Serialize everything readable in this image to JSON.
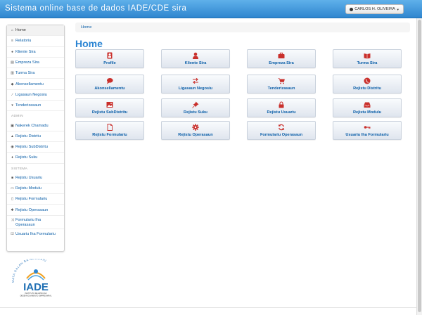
{
  "app": {
    "title": "Sistema online base de dados IADE/CDE sira",
    "user_label": "CARLOS H. OLIVEIRA"
  },
  "sidebar": {
    "items_main": [
      {
        "label": "Home",
        "icon": "home-icon"
      },
      {
        "label": "Relatoriu",
        "icon": "list-icon"
      },
      {
        "label": "Kliente Sira",
        "icon": "user-icon"
      },
      {
        "label": "Empreza Sira",
        "icon": "building-icon"
      },
      {
        "label": "Turma Sira",
        "icon": "book-icon"
      },
      {
        "label": "Akonsellamentu",
        "icon": "comment-icon"
      },
      {
        "label": "Ligasaun Negosiu",
        "icon": "link-icon"
      },
      {
        "label": "Tenderizasaun",
        "icon": "cart-icon"
      }
    ],
    "admin_header": "ADMIN",
    "items_admin": [
      {
        "label": "Nakerek Chamadu",
        "icon": "folder-icon"
      },
      {
        "label": "Rejistu Distritu",
        "icon": "road-icon"
      },
      {
        "label": "Rejistu SubDistritu",
        "icon": "globe-icon"
      },
      {
        "label": "Rejistu Suku",
        "icon": "map-marker-icon"
      }
    ],
    "sistema_header": "SISTEMA",
    "items_sistema": [
      {
        "label": "Rejistu Usuariu",
        "icon": "lock-icon"
      },
      {
        "label": "Rejistu Modulu",
        "icon": "inbox-icon"
      },
      {
        "label": "Rejistu Formulariu",
        "icon": "file-icon"
      },
      {
        "label": "Rejistu Operasaun",
        "icon": "cog-icon"
      },
      {
        "label": "Formulariu Iha Operasaun",
        "icon": "random-icon"
      },
      {
        "label": "Usuariu Iha Formulariu",
        "icon": "check-icon"
      }
    ]
  },
  "breadcrumb": "Home",
  "page_title": "Home",
  "tiles": [
    {
      "label": "Profile",
      "icon": "profile-icon"
    },
    {
      "label": "Kliente Sira",
      "icon": "user-icon"
    },
    {
      "label": "Empreza Sira",
      "icon": "briefcase-icon"
    },
    {
      "label": "Turma Sira",
      "icon": "book-icon"
    },
    {
      "label": "Akonsellamentu",
      "icon": "comment-icon"
    },
    {
      "label": "Ligasaun Negosiu",
      "icon": "transfer-icon"
    },
    {
      "label": "Tenderizasaun",
      "icon": "cart-icon"
    },
    {
      "label": "Rejistu Distritu",
      "icon": "globe-icon"
    },
    {
      "label": "Rejistu SubDistritu",
      "icon": "picture-icon"
    },
    {
      "label": "Rejistu Suku",
      "icon": "pushpin-icon"
    },
    {
      "label": "Rejistu Usuariu",
      "icon": "lock-icon"
    },
    {
      "label": "Rejistu Modulu",
      "icon": "inbox-icon"
    },
    {
      "label": "Rejistu Formulariu",
      "icon": "file-icon"
    },
    {
      "label": "Rejistu Operasaun",
      "icon": "cog-icon"
    },
    {
      "label": "Formulariu Operasaun",
      "icon": "refresh-icon"
    },
    {
      "label": "Usuariu Iha Formulariu",
      "icon": "key-icon"
    }
  ],
  "logo": {
    "text": "IADE",
    "arc_text": "MATA DALAN BA NEGOSIU",
    "caption_line1": "INSTITUTO DE APOIO AO",
    "caption_line2": "DESENVOLVIMENTO EMPRESARIAL"
  },
  "colors": {
    "accent": "#2a84d3",
    "link": "#0a5ea8",
    "icon_red": "#c9302c"
  }
}
